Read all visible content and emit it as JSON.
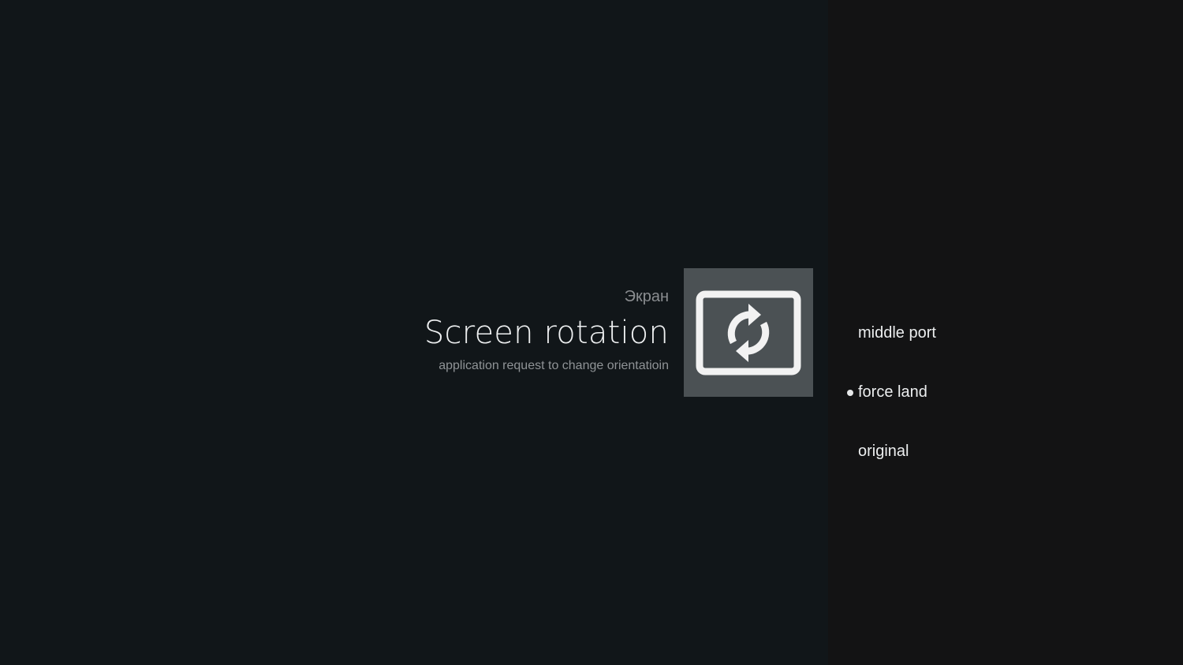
{
  "guidance": {
    "breadcrumb": "Экран",
    "title": "Screen rotation",
    "description": "application request to change orientatioin",
    "icon": "screen-rotation-icon"
  },
  "options": {
    "items": [
      {
        "label": "middle port",
        "selected": false
      },
      {
        "label": "force land",
        "selected": true
      },
      {
        "label": "original",
        "selected": false
      }
    ]
  },
  "colors": {
    "background": "#111619",
    "actions_background": "#131314",
    "icon_tile": "#4b5154",
    "icon_foreground": "#f2f2f2",
    "title_text": "#eef0f1",
    "secondary_text": "#8a8d90"
  }
}
